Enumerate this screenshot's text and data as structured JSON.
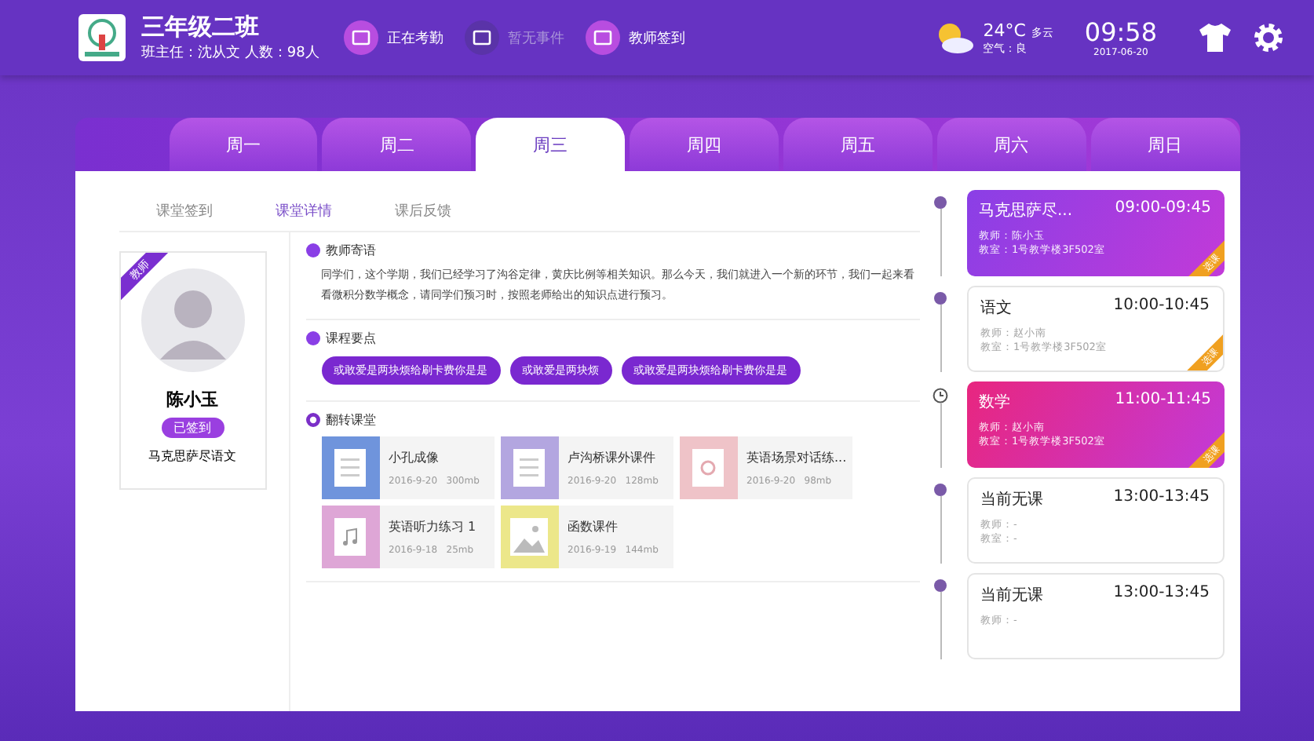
{
  "header": {
    "class_name": "三年级二班",
    "info": "班主任：沈从文  人数：98人",
    "actions": [
      {
        "label": "正在考勤",
        "disabled": false
      },
      {
        "label": "暂无事件",
        "disabled": true
      },
      {
        "label": "教师签到",
        "disabled": false
      }
    ],
    "weather": {
      "temp": "24°C",
      "desc": "多云",
      "air": "空气：良"
    },
    "time": "09:58",
    "date": "2017-06-20"
  },
  "days": [
    {
      "label": "周一",
      "selected": false
    },
    {
      "label": "周二",
      "selected": false
    },
    {
      "label": "周三",
      "selected": true
    },
    {
      "label": "周四",
      "selected": false
    },
    {
      "label": "周五",
      "selected": false
    },
    {
      "label": "周六",
      "selected": false
    },
    {
      "label": "周日",
      "selected": false
    }
  ],
  "subtabs": [
    {
      "label": "课堂签到",
      "selected": false
    },
    {
      "label": "课堂详情",
      "selected": true
    },
    {
      "label": "课后反馈",
      "selected": false
    }
  ],
  "teacher": {
    "ribbon": "教师",
    "name": "陈小玉",
    "status": "已签到",
    "subject": "马克思萨尽语文"
  },
  "sections": {
    "message_title": "教师寄语",
    "message": "同学们，这个学期，我们已经学习了沟谷定律，黄庆比例等相关知识。那么今天，我们就进入一个新的环节，我们一起来看看微积分数学概念，请同学们预习时，按照老师给出的知识点进行预习。",
    "points_title": "课程要点",
    "points": [
      "或敢爱是两块烦给刷卡费你是是",
      "或敢爱是两块烦",
      "或敢爱是两块烦给刷卡费你是是"
    ],
    "files_title": "翻转课堂",
    "files": [
      {
        "kind": "doc",
        "color": "#6f94dc",
        "name": "小孔成像",
        "date": "2016-9-20",
        "size": "300mb"
      },
      {
        "kind": "doc",
        "color": "#b3a6e0",
        "name": "卢沟桥课外课件",
        "date": "2016-9-20",
        "size": "128mb"
      },
      {
        "kind": "video",
        "color": "#efc3c8",
        "name": "英语场景对话练...",
        "date": "2016-9-20",
        "size": "98mb"
      },
      {
        "kind": "music",
        "color": "#dea6d6",
        "name": "英语听力练习 1",
        "date": "2016-9-18",
        "size": "25mb"
      },
      {
        "kind": "image",
        "color": "#ece78a",
        "name": "函数课件",
        "date": "2016-9-19",
        "size": "144mb"
      }
    ]
  },
  "schedule": [
    {
      "kind": "colored",
      "color": "#8a3fe6",
      "current": false,
      "subject": "马克思萨尽...",
      "time": "09:00-09:45",
      "teacher": "教师：陈小玉",
      "room": "教室：1号教学楼3F502室",
      "ribbon": "选课"
    },
    {
      "kind": "plain",
      "current": false,
      "subject": "语文",
      "time": "10:00-10:45",
      "teacher": "教师：赵小南",
      "room": "教室：1号教学楼3F502室",
      "ribbon": "选课"
    },
    {
      "kind": "colored",
      "color": "#e8267f",
      "current": true,
      "subject": "数学",
      "time": "11:00-11:45",
      "teacher": "教师：赵小南",
      "room": "教室：1号教学楼3F502室",
      "ribbon": "选课"
    },
    {
      "kind": "plain",
      "current": false,
      "subject": "当前无课",
      "time": "13:00-13:45",
      "teacher": "教师：-",
      "room": "教室：-"
    },
    {
      "kind": "plain",
      "current": false,
      "subject": "当前无课",
      "time": "13:00-13:45",
      "teacher": "教师：-"
    }
  ]
}
